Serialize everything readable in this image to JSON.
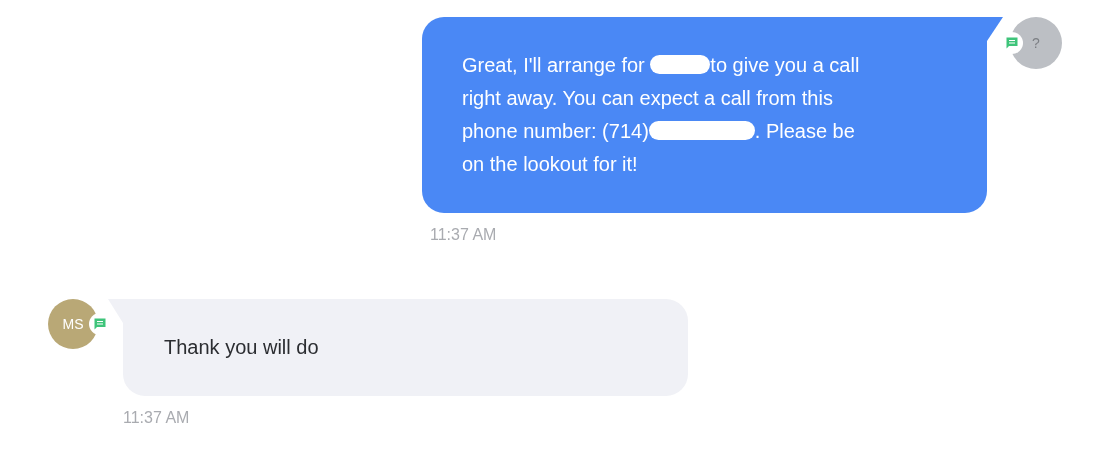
{
  "messages": [
    {
      "kind": "outgoing",
      "avatar": {
        "initials": "?",
        "color": "#bcbfc4"
      },
      "lines": [
        [
          {
            "kind": "text",
            "text": "Great, I'll arrange for "
          },
          {
            "kind": "blot"
          },
          {
            "kind": "text",
            "text": "to give you a call"
          }
        ],
        [
          {
            "kind": "text",
            "text": "right away. You can expect a call from this"
          }
        ],
        [
          {
            "kind": "text",
            "text": "phone number: (714)"
          },
          {
            "kind": "smear"
          },
          {
            "kind": "text",
            "text": ". Please be"
          }
        ],
        [
          {
            "kind": "text",
            "text": "on the lookout for it!"
          }
        ]
      ],
      "time": "11:37 AM"
    },
    {
      "kind": "incoming",
      "avatar": {
        "initials": "MS",
        "color": "#b9a876"
      },
      "lines": [
        [
          {
            "kind": "text",
            "text": "Thank you will do"
          }
        ]
      ],
      "time": "11:37 AM"
    }
  ]
}
